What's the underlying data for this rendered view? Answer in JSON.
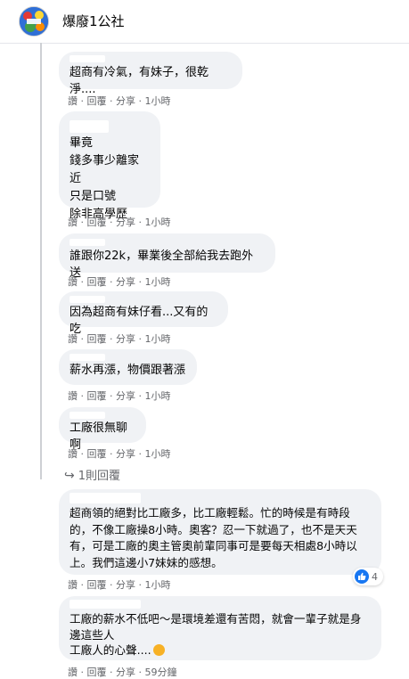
{
  "header": {
    "page_name": "爆廢1公社"
  },
  "comments": [
    {
      "text": "超商有冷氣，有妹子，很乾淨....",
      "time": "1小時"
    },
    {
      "text": "畢竟\n錢多事少離家近\n只是口號\n除非高學歷",
      "time": "1小時"
    },
    {
      "text": "誰跟你22k，畢業後全部給我去跑外送",
      "time": "1小時"
    },
    {
      "text": "因為超商有妹仔看...又有的吃",
      "time": "1小時"
    },
    {
      "text": "薪水再漲，物價跟著漲",
      "time": "1小時"
    },
    {
      "text": "工廠很無聊啊",
      "time": "1小時"
    },
    {
      "text": "超商領的絕對比工廠多，比工廠輕鬆。忙的時候是有時段的，不像工廠操8小時。奧客？忍一下就過了，也不是天天有，可是工廠的奧主管奧前輩同事可是要每天相處8小時以上。我們這邊小7妹妹的感想。",
      "time": "1小時",
      "reaction_count": "4"
    },
    {
      "text": "工廠的薪水不低吧～是環境差還有苦悶，就會一輩子就是身邊這些人\n工廠人的心聲....",
      "time": "59分鐘"
    }
  ],
  "actions": {
    "like": "讚",
    "reply": "回覆",
    "share": "分享",
    "sep": "·"
  },
  "reply_link": {
    "icon": "↪",
    "label": "1則回覆"
  },
  "colors": {
    "bubble": "#f0f2f5",
    "meta": "#65676b",
    "like_blue": "#1877f2"
  }
}
